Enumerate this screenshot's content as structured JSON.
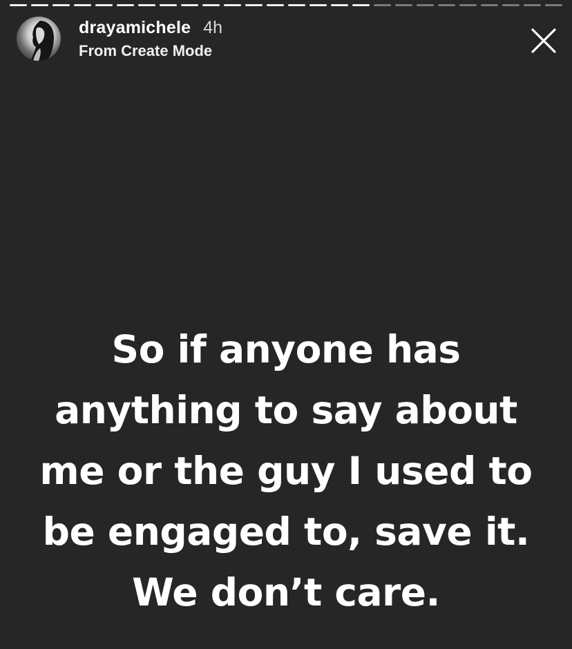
{
  "story": {
    "progress": {
      "total_segments": 26,
      "completed_segments": 17
    },
    "user": {
      "username": "drayamichele",
      "time_ago": "4h",
      "subtitle": "From Create Mode"
    },
    "close_icon": "close-icon",
    "caption_lines": [
      "So if anyone has",
      "anything to say about",
      "me or the guy I used to",
      "be engaged to, save it.",
      "We don’t care."
    ],
    "colors": {
      "background": "#262626",
      "text": "#ffffff",
      "progress_done": "#f2f2f2",
      "progress_remaining": "#7a7a7a"
    }
  }
}
